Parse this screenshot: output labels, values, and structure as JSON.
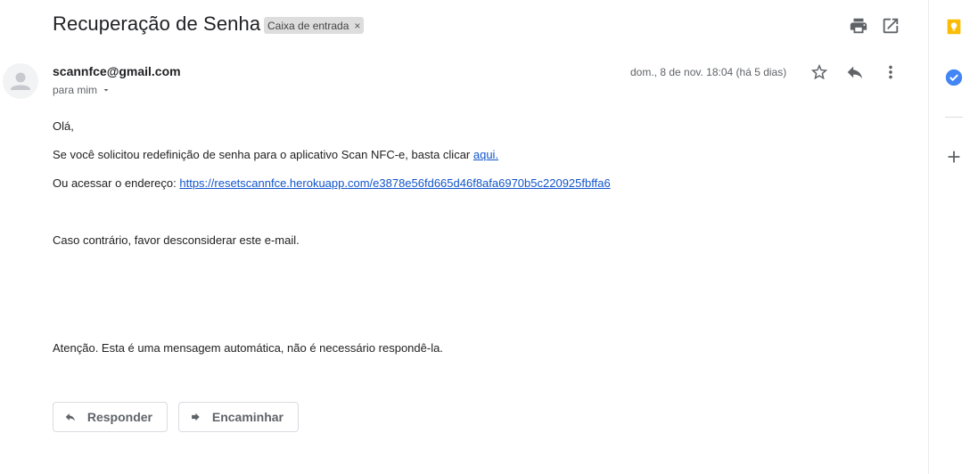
{
  "email": {
    "subject": "Recuperação de Senha",
    "label": "Caixa de entrada",
    "sender": "scannfce@gmail.com",
    "recipient_text": "para mim",
    "date": "dom., 8 de nov. 18:04 (há 5 dias)"
  },
  "body": {
    "greeting": "Olá,",
    "line1_text": "Se você solicitou redefinição de senha para o aplicativo Scan NFC-e, basta clicar ",
    "line1_link": "aqui.",
    "line2_text": "Ou acessar o endereço: ",
    "line2_link": "https://resetscannfce.herokuapp.com/e3878e56fd665d46f8afa6970b5c220925fbffa6",
    "line3": "Caso contrário, favor desconsiderar este e-mail.",
    "line4": "Atenção. Esta é uma mensagem automática, não é necessário respondê-la."
  },
  "actions": {
    "reply_label": "Responder",
    "forward_label": "Encaminhar"
  },
  "icons": {
    "top": [
      "print-icon",
      "open-in-new-window-icon"
    ],
    "header": [
      "star-icon",
      "reply-icon",
      "more-vert-icon"
    ],
    "sidebar": [
      "keep-icon",
      "tasks-icon",
      "add-icon"
    ]
  },
  "colors": {
    "link": "#1155cc",
    "keep": "#fbbc04",
    "tasks": "#4285f4",
    "chip_bg": "#dddddd"
  }
}
